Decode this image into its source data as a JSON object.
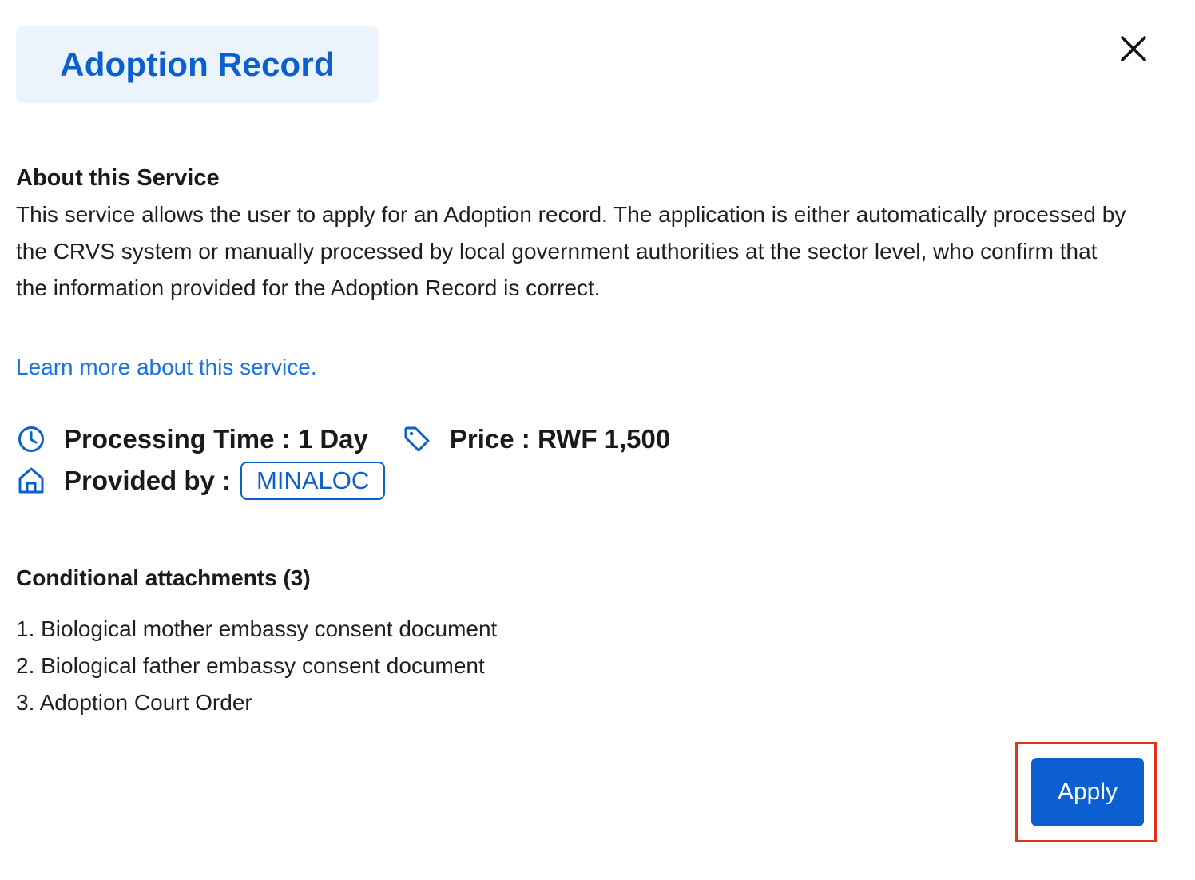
{
  "modal": {
    "title": "Adoption Record",
    "close_icon": "close-icon"
  },
  "about": {
    "heading": "About this Service",
    "description": "This service allows the user to apply for an Adoption record. The application is either automatically processed by the CRVS system or manually processed by local government authorities at the sector level, who confirm that the information provided for the Adoption Record is correct.",
    "learn_more_link": "Learn more about this service."
  },
  "meta": {
    "processing_time_label": "Processing Time : 1 Day",
    "processing_icon": "clock-icon",
    "price_label": "Price : RWF 1,500",
    "price_icon": "tag-icon",
    "provided_by_label": "Provided by :",
    "provided_by_icon": "home-icon",
    "provider": "MINALOC"
  },
  "attachments": {
    "heading": "Conditional attachments (3)",
    "items": [
      "1. Biological mother embassy consent document",
      "2. Biological father embassy consent document",
      "3. Adoption Court Order"
    ]
  },
  "actions": {
    "apply_label": "Apply"
  },
  "colors": {
    "primary": "#0b5fcf",
    "link": "#1a73e8",
    "title_chip_bg": "#ebf3fd",
    "highlight": "#e5321d"
  }
}
